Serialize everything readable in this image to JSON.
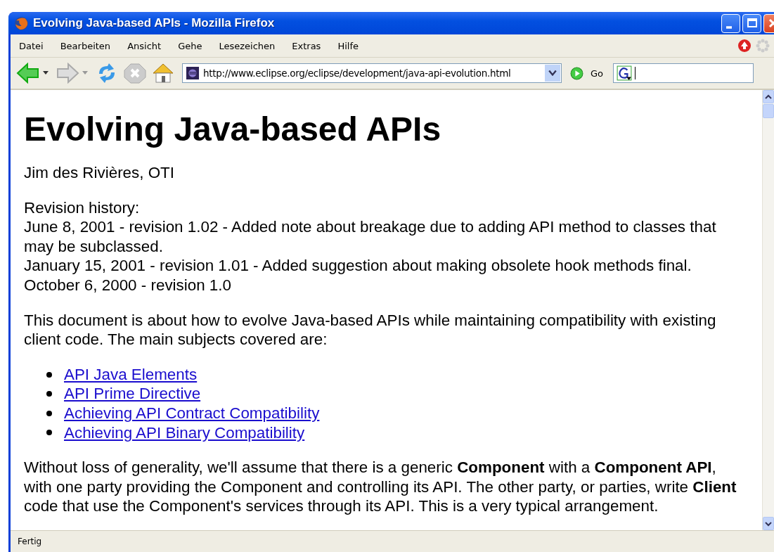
{
  "window": {
    "title": "Evolving Java-based APIs - Mozilla Firefox"
  },
  "menu": [
    {
      "label": "Datei"
    },
    {
      "label": "Bearbeiten"
    },
    {
      "label": "Ansicht"
    },
    {
      "label": "Gehe"
    },
    {
      "label": "Lesezeichen"
    },
    {
      "label": "Extras"
    },
    {
      "label": "Hilfe"
    }
  ],
  "toolbar": {
    "address": "http://www.eclipse.org/eclipse/development/java-api-evolution.html",
    "go_label": "Go"
  },
  "page": {
    "heading": "Evolving Java-based APIs",
    "author": "Jim des Rivières, OTI",
    "revision_lines": [
      "Revision history:",
      "June 8, 2001 - revision 1.02 - Added note about breakage due to adding API method to classes that may be subclassed.",
      "January 15, 2001 - revision 1.01 - Added suggestion about making obsolete hook methods final.",
      "October 6, 2000 - revision 1.0"
    ],
    "intro": "This document is about how to evolve Java-based APIs while maintaining compatibility with existing client code. The main subjects covered are:",
    "links": [
      "API Java Elements",
      "API Prime Directive",
      "Achieving API Contract Compatibility",
      "Achieving API Binary Compatibility"
    ],
    "paragraph": "Without loss of generality, we'll assume that there is a generic **Component** with a **Component API**, with one party providing the Component and controlling its API. The other party, or parties, write **Client** code that use the Component's services through its API. This is a very typical arrangement."
  },
  "status_bar": {
    "text": "Fertig"
  }
}
